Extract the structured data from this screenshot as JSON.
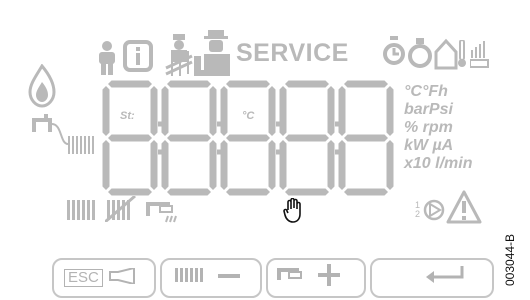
{
  "display": {
    "service_label": "SERVICE",
    "segment_tags": {
      "start": "St:",
      "celsius": "°C"
    },
    "units": [
      "°C°Fh",
      "barPsi",
      "% rpm",
      "kW µA",
      "x10 l/min"
    ],
    "reference_code": "003044-B"
  },
  "buttons": [
    {
      "id": "esc",
      "label": "ESC",
      "icon": "horn-icon"
    },
    {
      "id": "heating-minus",
      "label": "",
      "icon": "radiator-minus-icon"
    },
    {
      "id": "dhw-plus",
      "label": "",
      "icon": "tap-plus-icon"
    },
    {
      "id": "enter",
      "label": "",
      "icon": "enter-arrow-icon"
    }
  ],
  "colors": {
    "segment": "#b9b9b9",
    "active": "#111111",
    "frame": "#c6c6c6"
  }
}
